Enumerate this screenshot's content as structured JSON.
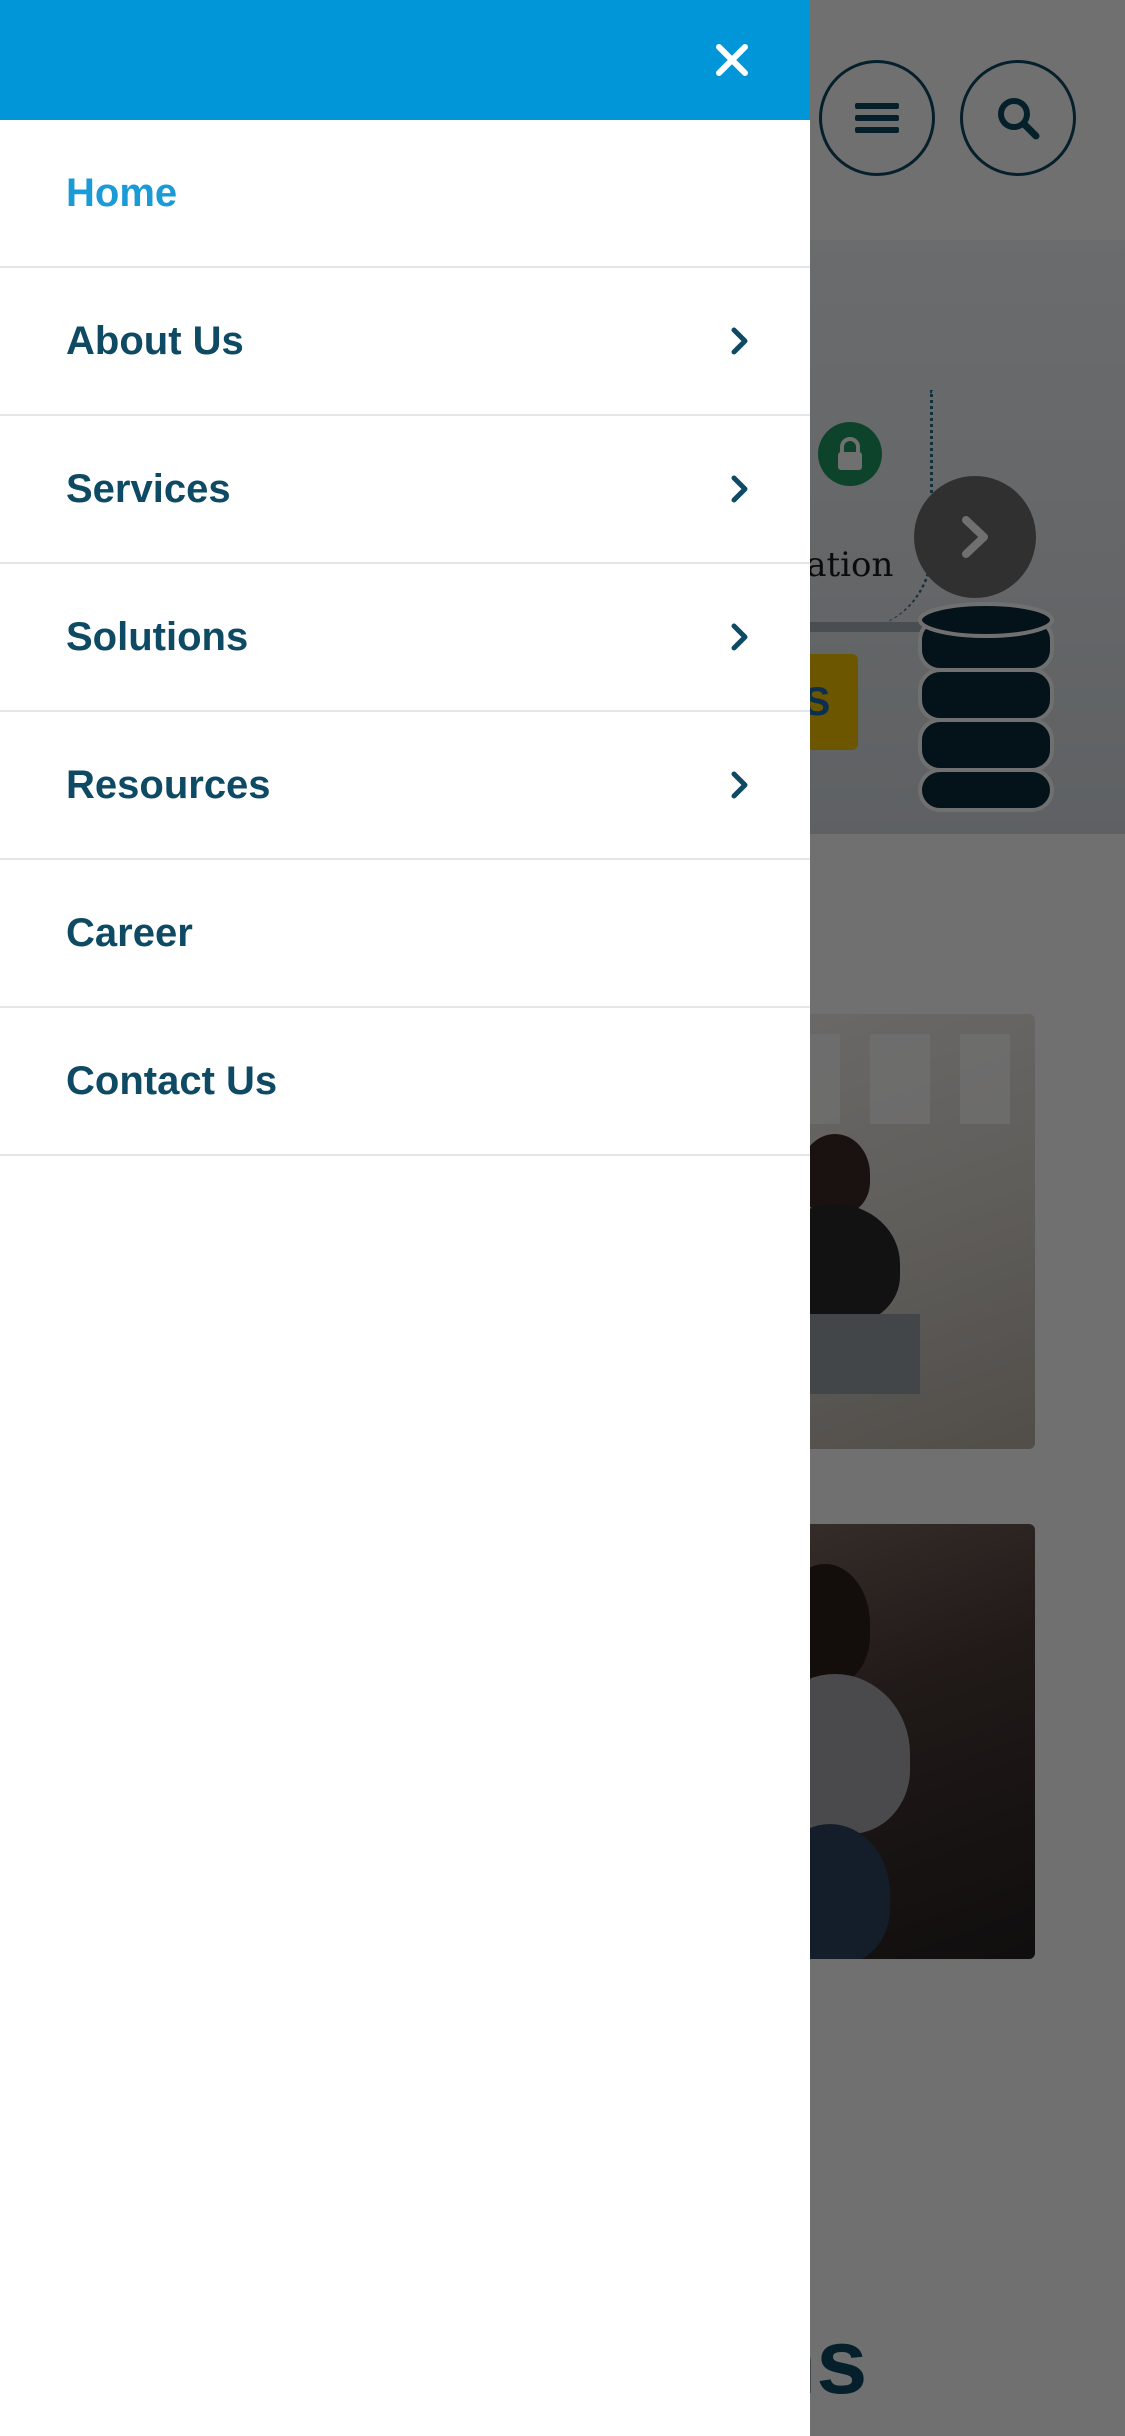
{
  "drawer": {
    "items": [
      {
        "label": "Home",
        "active": true,
        "has_submenu": false
      },
      {
        "label": "About Us",
        "active": false,
        "has_submenu": true
      },
      {
        "label": "Services",
        "active": false,
        "has_submenu": true
      },
      {
        "label": "Solutions",
        "active": false,
        "has_submenu": true
      },
      {
        "label": "Resources",
        "active": false,
        "has_submenu": true
      },
      {
        "label": "Career",
        "active": false,
        "has_submenu": false
      },
      {
        "label": "Contact Us",
        "active": false,
        "has_submenu": false
      }
    ],
    "close_icon": "close-icon",
    "submenu_icon": "chevron-right-icon"
  },
  "background": {
    "hero_text_fragment": "ration",
    "ssis_fragment": "S",
    "heading_fragment": "ns"
  },
  "colors": {
    "drawer_header": "#0096d8",
    "active_item": "#1a9ad6",
    "item_text": "#0e4a63",
    "divider": "#e4e6e8"
  }
}
